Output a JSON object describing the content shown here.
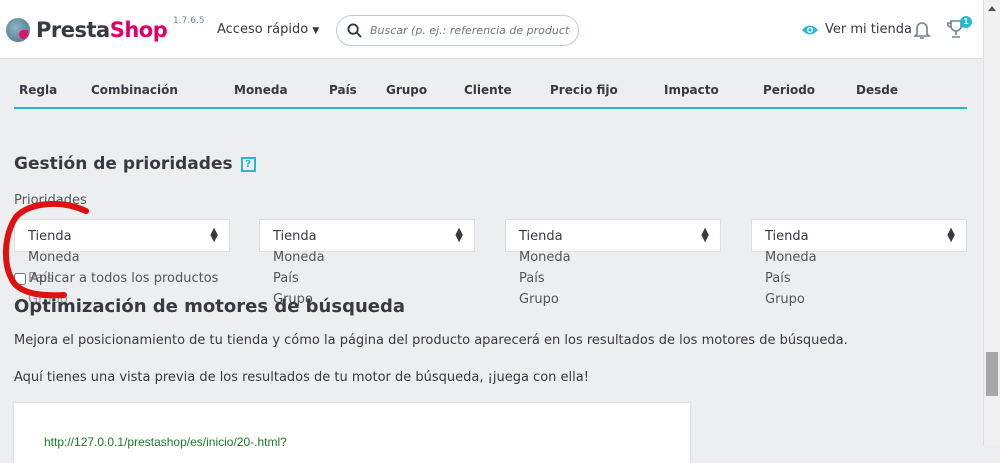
{
  "header": {
    "logo_part1": "Presta",
    "logo_part2": "Shop",
    "version": "1.7.6.5",
    "quick_access": "Acceso rápido",
    "search_placeholder": "Buscar (p. ej.: referencia de producto, nombre de cliente...)",
    "view_store": "Ver mi tienda",
    "notification_count": "1"
  },
  "table": {
    "columns": [
      "Regla",
      "Combinación",
      "Moneda",
      "País",
      "Grupo",
      "Cliente",
      "Precio fijo",
      "Impacto",
      "Periodo",
      "Desde"
    ]
  },
  "priorities": {
    "title": "Gestión de prioridades",
    "help": "?",
    "label": "Prioridades",
    "selects": [
      {
        "value": "Tienda"
      },
      {
        "value": "Tienda"
      },
      {
        "value": "Tienda"
      },
      {
        "value": "Tienda"
      }
    ],
    "options": [
      "Moneda",
      "País",
      "Grupo"
    ],
    "apply_all": "Aplicar a todos los productos"
  },
  "seo": {
    "title": "Optimización de motores de búsqueda",
    "desc1": "Mejora el posicionamiento de tu tienda y cómo la página del producto aparecerá en los resultados de los motores de búsqueda.",
    "desc2": "Aquí tienes una vista previa de los resultados de tu motor de búsqueda, ¡juega con ella!",
    "preview_url": "http://127.0.0.1/prestashop/es/inicio/20-.html?"
  },
  "colors": {
    "accent": "#25b9d7",
    "brand": "#df0067",
    "annotation": "#e01010"
  }
}
